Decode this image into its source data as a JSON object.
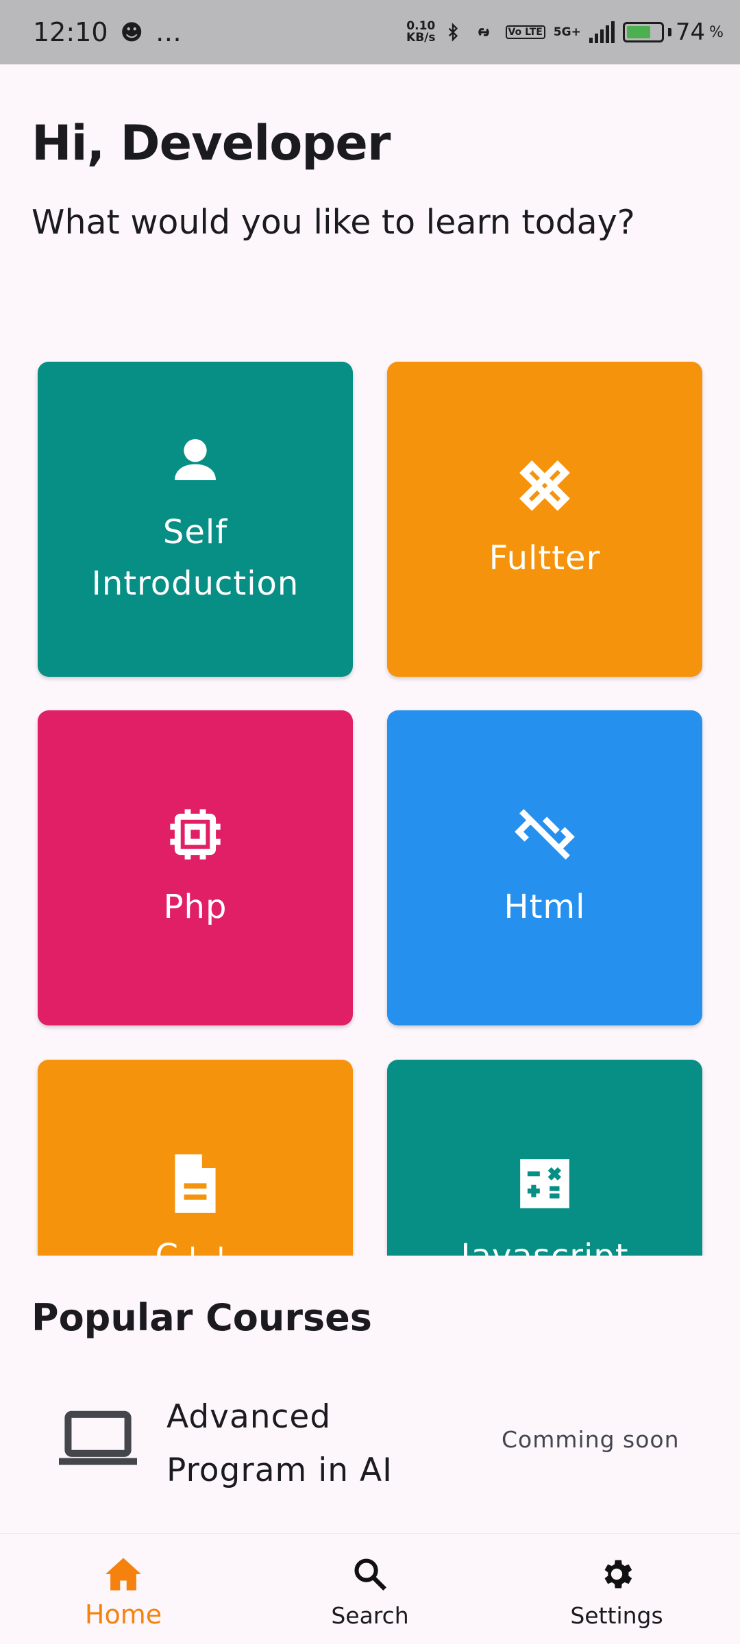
{
  "status_bar": {
    "time": "12:10",
    "more": "…",
    "net_speed_value": "0.10",
    "net_speed_unit": "KB/s",
    "volte": "Vo LTE",
    "network": "5G+",
    "battery_percent": "74",
    "battery_percent_suffix": "%",
    "battery_level": 0.74
  },
  "greeting": "Hi, Developer",
  "subtitle": "What would you like to learn today?",
  "categories": [
    {
      "label": "Self Introduction",
      "color": "#078f85",
      "icon": "person-icon"
    },
    {
      "label": "Fultter",
      "color": "#f5930d",
      "icon": "tools-icon"
    },
    {
      "label": "Php",
      "color": "#e11f67",
      "icon": "chip-icon"
    },
    {
      "label": "Html",
      "color": "#2590ee",
      "icon": "code-off-icon"
    },
    {
      "label": "C++",
      "color": "#f5930d",
      "icon": "document-icon"
    },
    {
      "label": "Javascript",
      "color": "#078f85",
      "icon": "calculator-icon"
    }
  ],
  "popular": {
    "title": "Popular Courses",
    "courses": [
      {
        "title": "Advanced Program in AI",
        "status": "Comming soon",
        "icon": "laptop-icon"
      }
    ]
  },
  "bottom_nav": {
    "items": [
      {
        "label": "Home",
        "icon": "home-icon",
        "active": true
      },
      {
        "label": "Search",
        "icon": "search-icon",
        "active": false
      },
      {
        "label": "Settings",
        "icon": "gear-icon",
        "active": false
      }
    ],
    "active_color": "#f5820f"
  }
}
